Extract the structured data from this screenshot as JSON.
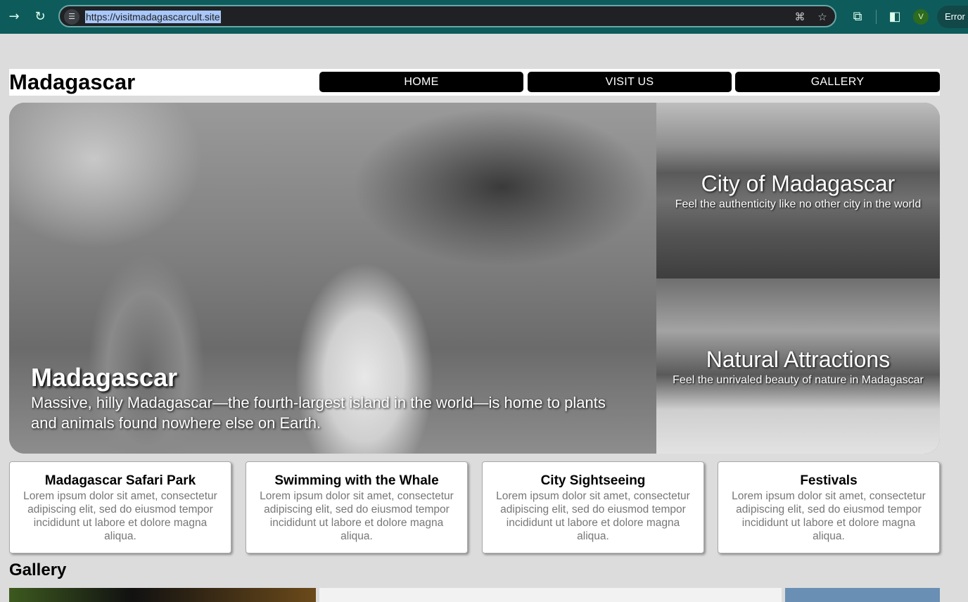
{
  "browser": {
    "url": "https://visitmadagascarcult.site",
    "profile_initial": "V",
    "status_pill": "Error",
    "icons": [
      "forward-icon",
      "reload-icon",
      "site-info-icon",
      "translate-icon",
      "bookmark-star-icon",
      "extensions-icon",
      "side-panel-icon"
    ]
  },
  "site": {
    "brand": "Madagascar",
    "nav": [
      "HOME",
      "VISIT US",
      "GALLERY"
    ]
  },
  "hero": {
    "main_title": "Madagascar",
    "main_desc": "Massive, hilly Madagascar—the fourth-largest island in the world—is home to plants and animals found nowhere else on Earth.",
    "city_title": "City of Madagascar",
    "city_sub": "Feel the authenticity like no other city in the world",
    "nature_title": "Natural Attractions",
    "nature_sub": "Feel the unrivaled beauty of nature in Madagascar"
  },
  "cards": [
    {
      "title": "Madagascar Safari Park",
      "text": "Lorem ipsum dolor sit amet, consectetur adipiscing elit, sed do eiusmod tempor incididunt ut labore et dolore magna aliqua."
    },
    {
      "title": "Swimming with the Whale",
      "text": "Lorem ipsum dolor sit amet, consectetur adipiscing elit, sed do eiusmod tempor incididunt ut labore et dolore magna aliqua."
    },
    {
      "title": "City Sightseeing",
      "text": "Lorem ipsum dolor sit amet, consectetur adipiscing elit, sed do eiusmod tempor incididunt ut labore et dolore magna aliqua."
    },
    {
      "title": "Festivals",
      "text": "Lorem ipsum dolor sit amet, consectetur adipiscing elit, sed do eiusmod tempor incididunt ut labore et dolore magna aliqua."
    }
  ],
  "gallery": {
    "title": "Gallery"
  }
}
